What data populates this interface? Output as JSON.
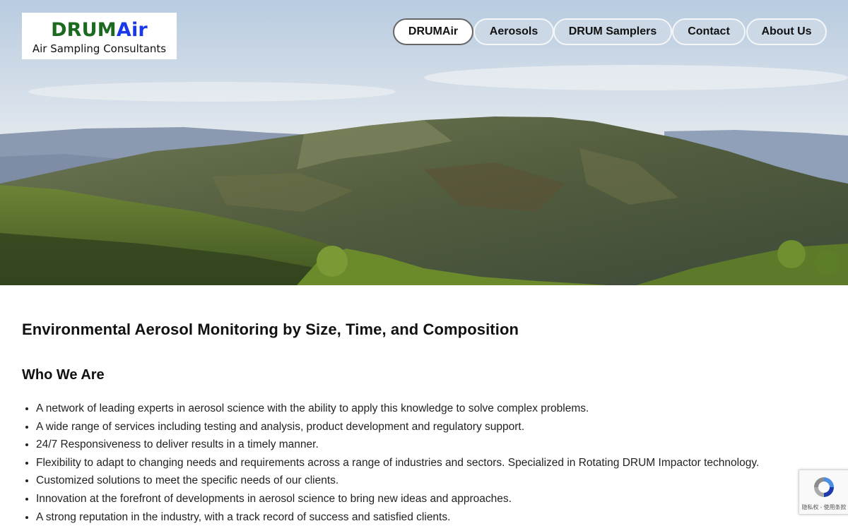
{
  "brand": {
    "name_part1": "DRUM",
    "name_part2": "Air",
    "tagline": "Air Sampling Consultants",
    "color_part1": "#1c6a1f",
    "color_part2": "#1939e8"
  },
  "nav": {
    "items": [
      {
        "label": "DRUMAir",
        "active": true
      },
      {
        "label": "Aerosols",
        "active": false
      },
      {
        "label": "DRUM Samplers",
        "active": false
      },
      {
        "label": "Contact",
        "active": false
      },
      {
        "label": "About Us",
        "active": false
      }
    ],
    "button_color": "#ccd8e6"
  },
  "main": {
    "heading": "Environmental Aerosol Monitoring by Size, Time, and Composition",
    "subheading": "Who We Are",
    "bullets": [
      "A network of leading experts in aerosol science with the ability to apply this knowledge to solve complex problems.",
      "A wide range of services including testing and analysis, product development and regulatory support.",
      "24/7 Responsiveness to deliver results in a timely manner.",
      "Flexibility to adapt to changing needs and requirements across a range of industries and sectors. Specialized in Rotating DRUM Impactor technology.",
      "Customized solutions to meet the specific needs of our clients.",
      "Innovation at the forefront of developments in aerosol science to bring new ideas and approaches.",
      "A strong reputation in the industry, with a track record of success and satisfied clients."
    ]
  },
  "recaptcha": {
    "footer_text": "隐私权 - 使用条款",
    "icon": "recaptcha-icon"
  }
}
